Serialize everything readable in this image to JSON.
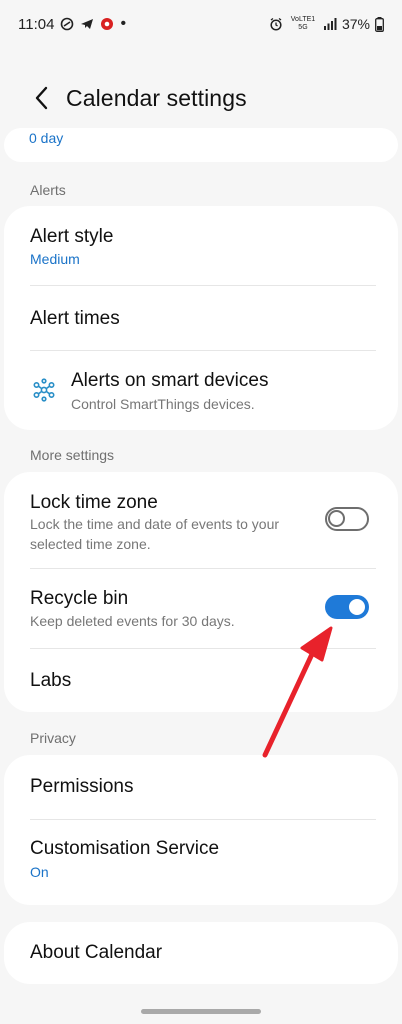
{
  "status": {
    "time": "11:04",
    "network": "VoLTE1 5G",
    "battery": "37%"
  },
  "header": {
    "title": "Calendar settings"
  },
  "top_card": {
    "value": "0 day"
  },
  "sections": {
    "alerts_label": "Alerts",
    "more_settings_label": "More settings",
    "privacy_label": "Privacy"
  },
  "alerts": {
    "alert_style": {
      "title": "Alert style",
      "value": "Medium"
    },
    "alert_times": {
      "title": "Alert times"
    },
    "smart_devices": {
      "title": "Alerts on smart devices",
      "subtitle": "Control SmartThings devices."
    }
  },
  "more_settings": {
    "lock_time_zone": {
      "title": "Lock time zone",
      "subtitle_line1": "Lock the time and date of events to your",
      "subtitle_line2": "selected time zone.",
      "enabled": false
    },
    "recycle_bin": {
      "title": "Recycle bin",
      "subtitle": "Keep deleted events for 30 days.",
      "enabled": true
    },
    "labs": {
      "title": "Labs"
    }
  },
  "privacy": {
    "permissions": {
      "title": "Permissions"
    },
    "customisation": {
      "title": "Customisation Service",
      "value": "On"
    }
  },
  "about": {
    "title": "About Calendar"
  },
  "colors": {
    "accent": "#1f7ad8",
    "link_value": "#1a73c8",
    "annotation_arrow": "#e8222b"
  }
}
